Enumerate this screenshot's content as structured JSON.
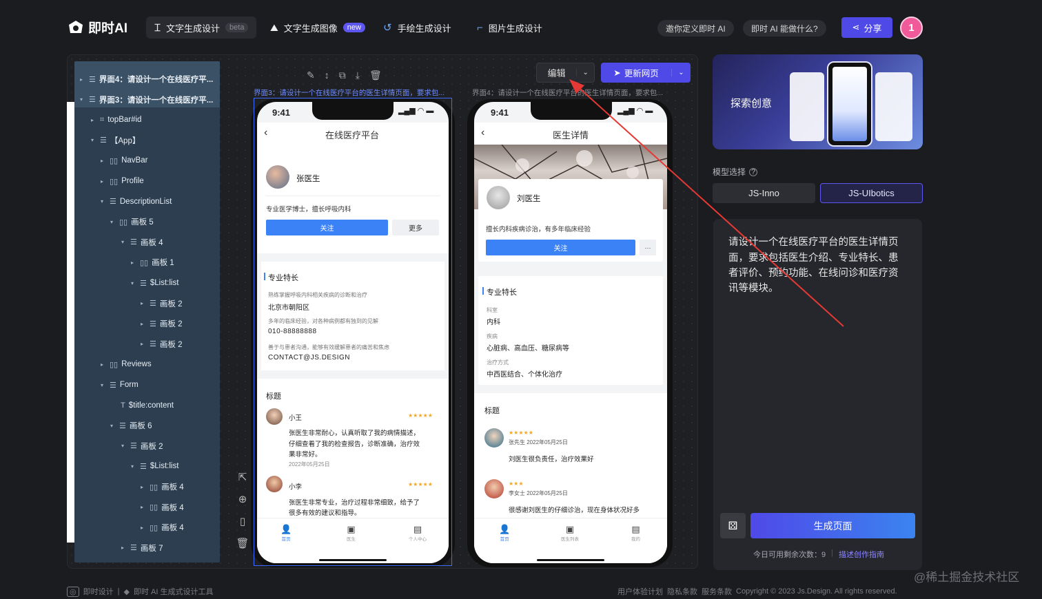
{
  "app": {
    "name": "即时AI"
  },
  "tabs": [
    {
      "label": "文字生成设计",
      "badge": "beta"
    },
    {
      "label": "文字生成图像",
      "badge": "new"
    },
    {
      "label": "手绘生成设计"
    },
    {
      "label": "图片生成设计"
    }
  ],
  "header": {
    "invite": "邀你定义即时 AI",
    "what": "即时 AI 能做什么?",
    "share": "分享",
    "user_initial": "1"
  },
  "toolbar": {
    "edit": "编辑",
    "update": "更新网页"
  },
  "frames": {
    "left_label": "界面3：请设计一个在线医疗平台的医生详情页面，要求包...",
    "right_label": "界面4：请设计一个在线医疗平台的医生详情页面，要求包..."
  },
  "layer_tree": [
    {
      "label": "界面4：请设计一个在线医疗平...",
      "bold": true,
      "arrow": "▸"
    },
    {
      "label": "界面3：请设计一个在线医疗平...",
      "bold": true,
      "arrow": "▾"
    },
    {
      "label": "topBar#id",
      "arrow": "▸",
      "icon": "⌗"
    },
    {
      "label": "【App】",
      "arrow": "▾",
      "icon": "☰"
    },
    {
      "label": "NavBar",
      "arrow": "▸",
      "icon": "▯▯"
    },
    {
      "label": "Profile",
      "arrow": "▸",
      "icon": "▯▯"
    },
    {
      "label": "DescriptionList",
      "arrow": "▾",
      "icon": "☰"
    },
    {
      "label": "画板 5",
      "arrow": "▾",
      "icon": "▯▯"
    },
    {
      "label": "画板 4",
      "arrow": "▾",
      "icon": "☰"
    },
    {
      "label": "画板 1",
      "arrow": "▸",
      "icon": "▯▯"
    },
    {
      "label": "$List:list",
      "arrow": "▾",
      "icon": "☰"
    },
    {
      "label": "画板 2",
      "arrow": "▸",
      "icon": "☰"
    },
    {
      "label": "画板 2",
      "arrow": "▸",
      "icon": "☰"
    },
    {
      "label": "画板 2",
      "arrow": "▸",
      "icon": "☰"
    },
    {
      "label": "Reviews",
      "arrow": "▸",
      "icon": "▯▯"
    },
    {
      "label": "Form",
      "arrow": "▾",
      "icon": "☰"
    },
    {
      "label": "$title:content",
      "arrow": "",
      "icon": "T"
    },
    {
      "label": "画板 6",
      "arrow": "▾",
      "icon": "☰"
    },
    {
      "label": "画板 2",
      "arrow": "▾",
      "icon": "☰"
    },
    {
      "label": "$List:list",
      "arrow": "▾",
      "icon": "☰"
    },
    {
      "label": "画板 4",
      "arrow": "▸",
      "icon": "▯▯"
    },
    {
      "label": "画板 4",
      "arrow": "▸",
      "icon": "▯▯"
    },
    {
      "label": "画板 4",
      "arrow": "▸",
      "icon": "▯▯"
    },
    {
      "label": "画板 7",
      "arrow": "▸",
      "icon": "☰"
    }
  ],
  "phone1": {
    "time": "9:41",
    "title": "在线医疗平台",
    "doctor": "张医生",
    "desc": "专业医学博士，擅长呼吸内科",
    "follow": "关注",
    "more": "更多",
    "section": "专业特长",
    "items": [
      {
        "label": "熟练掌握呼吸内科相关疾病的诊断和治疗",
        "value": "北京市朝阳区"
      },
      {
        "label": "多年的临床经验，对各种病例都有独到的见解",
        "value": "010-88888888"
      },
      {
        "label": "善于与患者沟通，能够有效缓解患者的痛苦和焦虑",
        "value": "CONTACT@JS.DESIGN"
      }
    ],
    "reviews_title": "标题",
    "reviews": [
      {
        "name": "小王",
        "stars": "★★★★★",
        "text1": "张医生非常耐心，认真听取了我的病情描述，",
        "text2": "仔细查看了我的检查报告，诊断准确，治疗效",
        "text3": "果非常好。",
        "date": "2022年05月25日"
      },
      {
        "name": "小李",
        "stars": "★★★★★",
        "text1": "张医生非常专业，治疗过程非常细致，给予了",
        "text2": "很多有效的建议和指导。"
      }
    ],
    "nav": [
      "首页",
      "医生",
      "个人中心"
    ]
  },
  "phone2": {
    "time": "9:41",
    "title": "医生详情",
    "doctor": "刘医生",
    "desc": "擅长内科疾病诊治，有多年临床经验",
    "follow": "关注",
    "more": "···",
    "section": "专业特长",
    "items": [
      {
        "label": "科室",
        "value": "内科"
      },
      {
        "label": "疾病",
        "value": "心脏病、高血压、糖尿病等"
      },
      {
        "label": "治疗方式",
        "value": "中西医结合、个体化治疗"
      }
    ],
    "reviews_title": "标题",
    "reviews": [
      {
        "stars": "★★★★★",
        "name": "张先生",
        "date": "2022年05月25日",
        "text": "刘医生很负责任，治疗效果好"
      },
      {
        "stars": "★★★",
        "name": "李女士",
        "date": "2022年05月25日",
        "text": "很感谢刘医生的仔细诊治，现在身体状况好多"
      }
    ],
    "nav": [
      "首页",
      "医生列表",
      "我的"
    ]
  },
  "right_panel": {
    "banner_text": "探索创意",
    "model_label": "模型选择",
    "models": [
      "JS-Inno",
      "JS-UIbotics"
    ],
    "prompt": [
      "请设计一个在线医疗平台的医生详情页",
      "面，要求包括医生介绍、专业特长、患",
      "者评价、预约功能、在线问诊和医疗资",
      "讯等模块。"
    ],
    "generate": "生成页面",
    "remaining": "今日可用剩余次数：9",
    "guide": "描述创作指南"
  },
  "footer": {
    "left1": "即时设计",
    "left2": "即时 AI 生成式设计工具",
    "links": [
      "用户体验计划",
      "隐私条款",
      "服务条款"
    ],
    "copyright": "Copyright © 2023 Js.Design. All rights reserved.",
    "watermark": "@稀土掘金技术社区"
  },
  "colors": {
    "accent": "#4f49e8",
    "primary_blue": "#3b82f6",
    "annotation_red": "#e53935",
    "tree_bg": "#2c3e50"
  }
}
